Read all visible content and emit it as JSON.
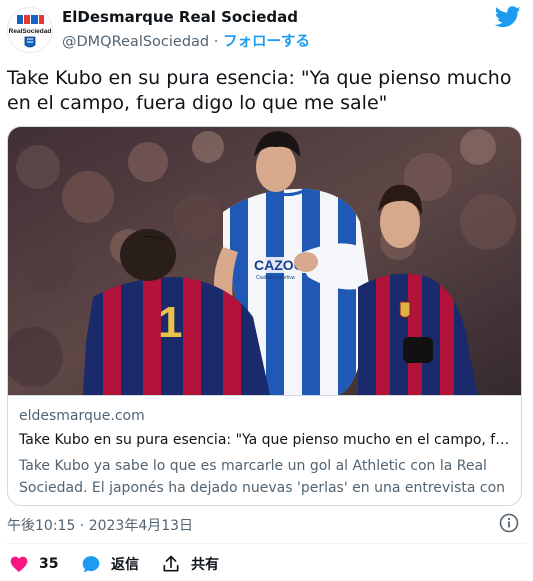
{
  "account": {
    "display_name": "ElDesmarque Real Sociedad",
    "handle": "@DMQRealSociedad",
    "separator": "·",
    "follow_label": "フォローする",
    "logo_text": "RealSociedad"
  },
  "tweet": {
    "text": "Take Kubo en su pura esencia: \"Ya que pienso mucho en el campo, fuera digo lo que me sale\""
  },
  "card": {
    "domain": "eldesmarque.com",
    "title": "Take Kubo en su pura esencia: \"Ya que pienso mucho en el campo, fuera...",
    "description": "Take Kubo ya sabe lo que es marcarle un gol al Athletic con la Real Sociedad. El japonés ha dejado nuevas 'perlas' en una entrevista con ...",
    "image_jersey_text": "CAZOO",
    "image_jersey_sub": "Ciudad Deportiva",
    "image_number": "1"
  },
  "meta": {
    "timestamp": "午後10:15 · 2023年4月13日"
  },
  "actions": {
    "like_count": "35",
    "reply_label": "返信",
    "share_label": "共有"
  },
  "colors": {
    "accent": "#1d9bf0",
    "like": "#f91880",
    "text": "#0f1419",
    "secondary": "#536471"
  }
}
